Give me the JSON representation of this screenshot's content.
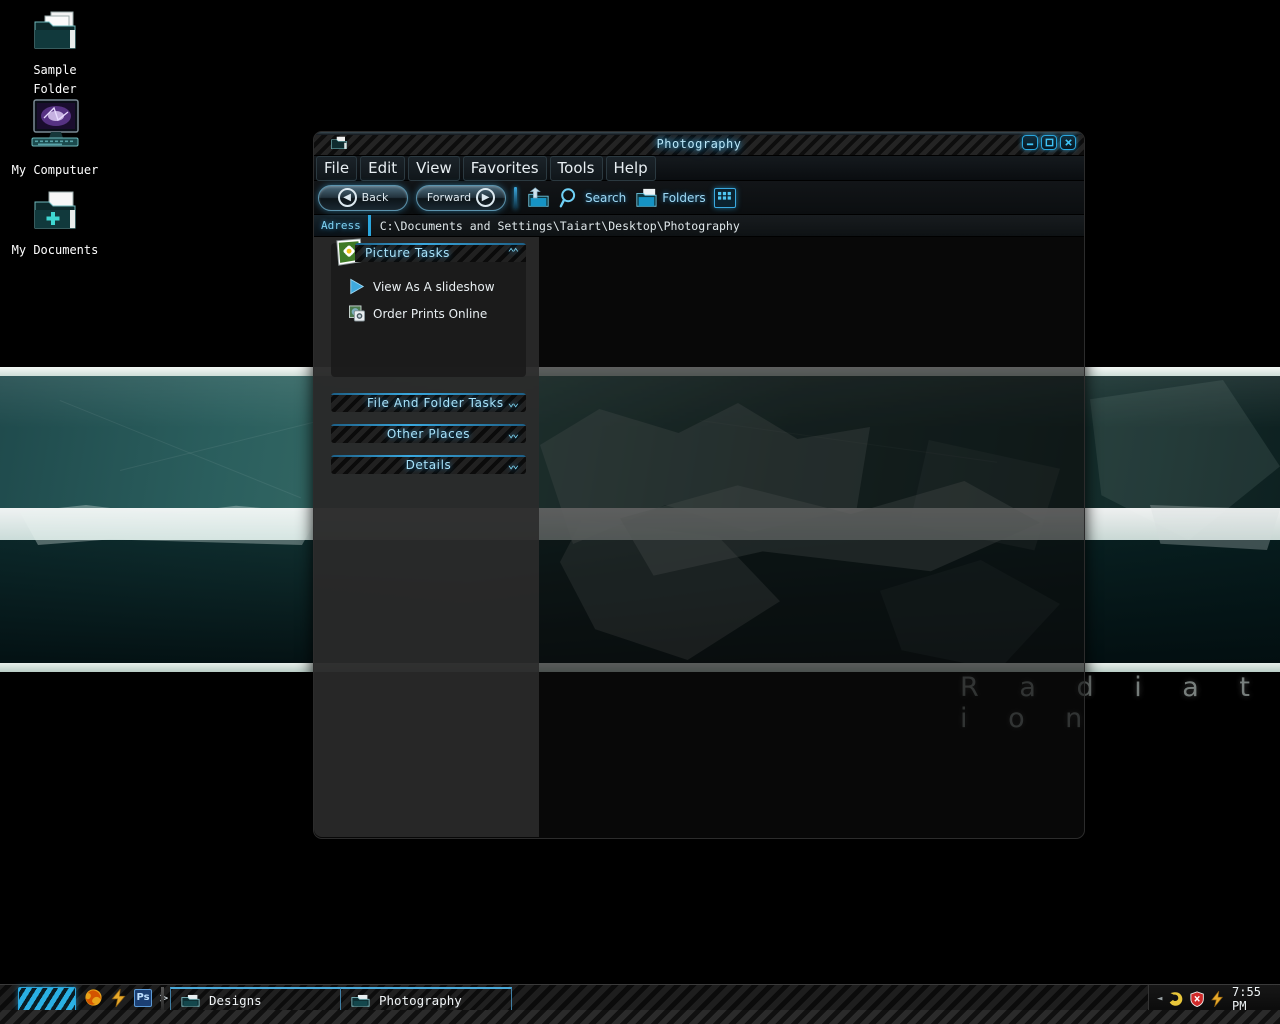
{
  "desktop": {
    "icons": [
      {
        "name": "sample-folder",
        "label_line1": "Sample",
        "label_line2": "Folder",
        "icon": "folder-icon"
      },
      {
        "name": "my-computer",
        "label_line1": "My Computuer",
        "label_line2": "",
        "icon": "computer-icon"
      },
      {
        "name": "my-documents",
        "label_line1": "My Documents",
        "label_line2": "",
        "icon": "folder-plus-icon"
      }
    ],
    "wallpaper_title": "R a d i a t i o n"
  },
  "window": {
    "title": "Photography",
    "titlebar_icon": "folder-icon",
    "buttons": {
      "minimize": "_",
      "maximize": "□",
      "close": "✕"
    },
    "menu": [
      {
        "name": "file",
        "label": "File"
      },
      {
        "name": "edit",
        "label": "Edit"
      },
      {
        "name": "view",
        "label": "View"
      },
      {
        "name": "favorites",
        "label": "Favorites"
      },
      {
        "name": "tools",
        "label": "Tools"
      },
      {
        "name": "help",
        "label": "Help"
      }
    ],
    "toolbar": {
      "back_label": "Back",
      "forward_label": "Forward",
      "up_icon": "up-folder-icon",
      "search_label": "Search",
      "search_icon": "magnifier-icon",
      "folders_label": "Folders",
      "folders_icon": "folder-icon",
      "views_icon": "views-grid-icon"
    },
    "address": {
      "label": "Adress",
      "path": "C:\\Documents and Settings\\Taiart\\Desktop\\Photography"
    },
    "sidebar": {
      "picture_tasks": {
        "title": "Picture  Tasks",
        "collapse_icon": "chevron-up-double-icon",
        "thumb_icon": "daisy-photo-icon",
        "items": [
          {
            "name": "view-as-slideshow",
            "label": "View  As  A  slideshow",
            "icon": "play-triangle-icon"
          },
          {
            "name": "order-prints-online",
            "label": "Order  Prints  Online",
            "icon": "camera-icon"
          }
        ]
      },
      "panels": [
        {
          "name": "file-and-folder-tasks",
          "title": "File  And  Folder  Tasks",
          "align": "left",
          "chevron": "chevron-down-double-icon"
        },
        {
          "name": "other-places",
          "title": "Other  Places",
          "align": "center",
          "chevron": "chevron-down-double-icon"
        },
        {
          "name": "details",
          "title": "Details",
          "align": "center",
          "chevron": "chevron-down-double-icon"
        }
      ]
    }
  },
  "taskbar": {
    "start_label": "",
    "quicklaunch": [
      {
        "name": "firefox",
        "icon": "firefox-icon"
      },
      {
        "name": "lightning",
        "icon": "lightning-icon"
      },
      {
        "name": "photoshop",
        "icon": "photoshop-icon",
        "label": "Ps"
      },
      {
        "name": "more",
        "icon": "chevron-right-icon",
        "label": ">"
      }
    ],
    "tasks": [
      {
        "name": "designs",
        "label": "Designs",
        "icon": "folder-icon"
      },
      {
        "name": "photography",
        "label": "Photography",
        "icon": "folder-icon"
      }
    ],
    "tray": {
      "arrow": "◄",
      "icons": [
        {
          "name": "yellow-tray-icon",
          "color": "#e8c63a"
        },
        {
          "name": "security-shield-icon",
          "color": "#cf2a2a"
        },
        {
          "name": "lightning-tray-icon",
          "color": "#e7a92a"
        }
      ],
      "clock": "7:55 PM"
    }
  },
  "colors": {
    "accent_cyan": "#2aa6de",
    "glow_cyan": "#7fd9f7",
    "window_bg": "#1a1a1a",
    "sidebar_bg": "#2a2a2a"
  }
}
